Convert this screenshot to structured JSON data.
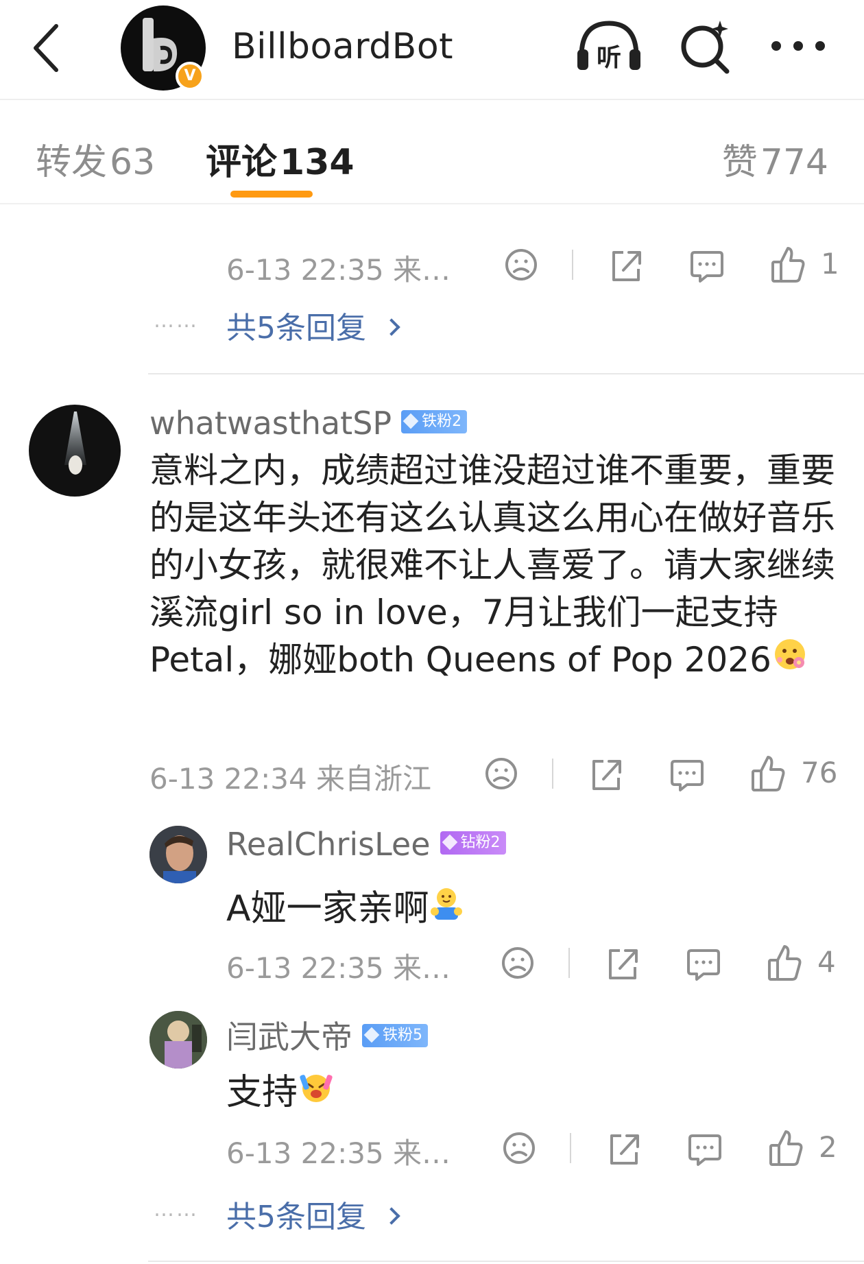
{
  "header": {
    "title": "BillboardBot",
    "verified_badge": "V"
  },
  "tabs": {
    "repost_label": "转发",
    "repost_count": "63",
    "comment_label": "评论",
    "comment_count": "134",
    "like_label": "赞",
    "like_count": "774",
    "active": "comment"
  },
  "colors": {
    "accent": "#ff9a12",
    "link": "#4a6ea9",
    "meta_gray": "#9a9a9a",
    "iron_badge": "#5a9df5",
    "diamond_badge": "#b169f2"
  },
  "top_fragment": {
    "meta": "6-13 22:35 来…",
    "like_count": "1",
    "more_replies": "共5条回复",
    "dots": "……"
  },
  "comment": {
    "username": "whatwasthatSP",
    "badge": "铁粉2",
    "text": "意料之内，成绩超过谁没超过谁不重要，重要的是这年头还有这么认真这么用心在做好音乐的小女孩，就很难不让人喜爱了。请大家继续溪流girl so in love，7月让我们一起支持Petal，娜娅both Queens of Pop 2026",
    "meta": "6-13 22:34  来自浙江",
    "like_count": "76"
  },
  "replies": [
    {
      "username": "RealChrisLee",
      "badge": "钻粉2",
      "text": "A娅一家亲啊",
      "meta": "6-13 22:35 来…",
      "like_count": "4"
    },
    {
      "username": "闫武大帝",
      "badge": "铁粉5",
      "text": "支持",
      "meta": "6-13 22:35 来…",
      "like_count": "2"
    }
  ],
  "bottom": {
    "more_replies": "共5条回复",
    "dots": "……"
  },
  "icons": {
    "back": "chevron-left-icon",
    "listen": "headphones-listen-icon",
    "search": "search-sparkle-icon",
    "more": "more-dots-icon",
    "dislike": "sad-face-icon",
    "share": "share-icon",
    "reply": "comment-bubble-icon",
    "like": "thumbs-up-icon"
  }
}
